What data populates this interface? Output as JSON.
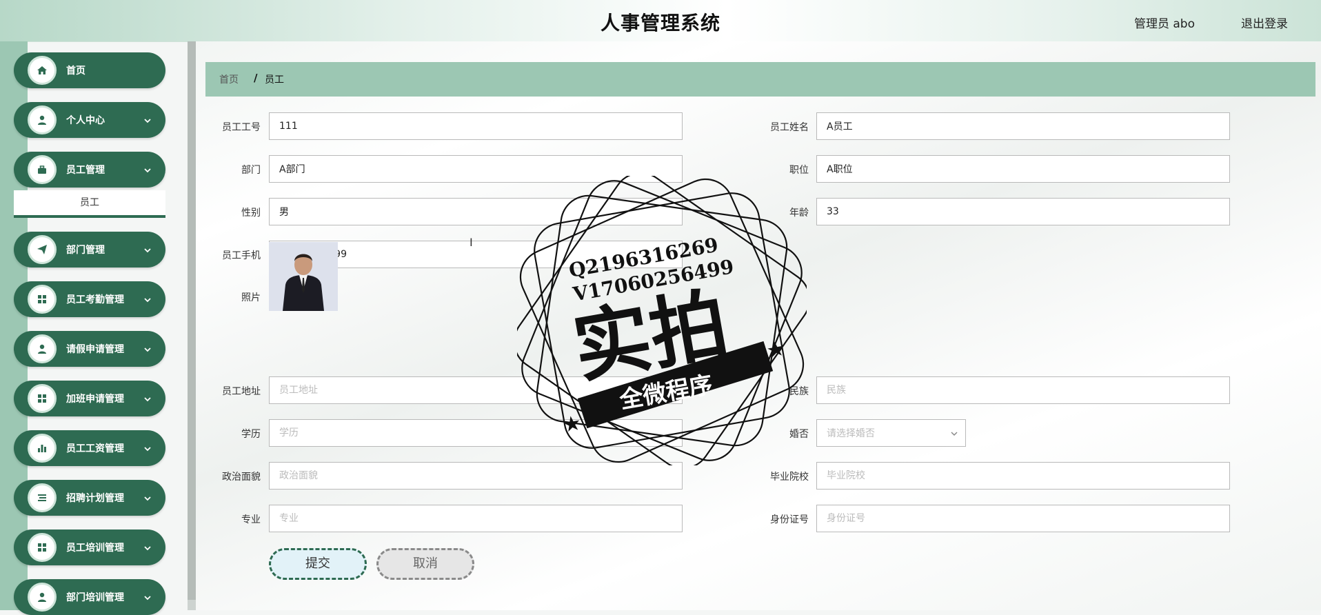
{
  "header": {
    "title": "人事管理系统",
    "user": "管理员 abo",
    "logout": "退出登录"
  },
  "sidebar": {
    "items": [
      {
        "label": "首页",
        "icon": "home-icon"
      },
      {
        "label": "个人中心",
        "icon": "user-icon"
      },
      {
        "label": "员工管理",
        "icon": "briefcase-icon",
        "expanded": true
      },
      {
        "label": "部门管理",
        "icon": "send-icon"
      },
      {
        "label": "员工考勤管理",
        "icon": "grid-icon"
      },
      {
        "label": "请假申请管理",
        "icon": "user-icon"
      },
      {
        "label": "加班申请管理",
        "icon": "grid-icon"
      },
      {
        "label": "员工工资管理",
        "icon": "bar-chart-icon"
      },
      {
        "label": "招聘计划管理",
        "icon": "list-icon"
      },
      {
        "label": "员工培训管理",
        "icon": "grid-icon"
      },
      {
        "label": "部门培训管理",
        "icon": "user-icon"
      }
    ],
    "subitem": "员工"
  },
  "breadcrumb": {
    "home": "首页",
    "separator": "/",
    "current": "员工"
  },
  "form": {
    "employee_no": {
      "label": "员工工号",
      "value": "111"
    },
    "employee_name": {
      "label": "员工姓名",
      "value": "A员工"
    },
    "department": {
      "label": "部门",
      "value": "A部门"
    },
    "position": {
      "label": "职位",
      "value": "A职位"
    },
    "gender": {
      "label": "性别",
      "value": "男"
    },
    "age": {
      "label": "年龄",
      "value": "33"
    },
    "phone": {
      "label": "员工手机",
      "value": "13899999999"
    },
    "photo": {
      "label": "照片"
    },
    "address": {
      "label": "员工地址",
      "placeholder": "员工地址"
    },
    "ethnicity": {
      "label": "民族",
      "placeholder": "民族"
    },
    "education": {
      "label": "学历",
      "placeholder": "学历"
    },
    "marital": {
      "label": "婚否",
      "placeholder": "请选择婚否"
    },
    "political": {
      "label": "政治面貌",
      "placeholder": "政治面貌"
    },
    "school": {
      "label": "毕业院校",
      "placeholder": "毕业院校"
    },
    "major": {
      "label": "专业",
      "placeholder": "专业"
    },
    "id_number": {
      "label": "身份证号",
      "placeholder": "身份证号"
    }
  },
  "buttons": {
    "submit": "提交",
    "cancel": "取消"
  },
  "watermark": {
    "line1": "Q2196316269",
    "line2": "V17060256499",
    "main": "实拍",
    "ribbon": "全微程序"
  },
  "colors": {
    "primary": "#2e6b52",
    "light": "#9cc7b3"
  }
}
